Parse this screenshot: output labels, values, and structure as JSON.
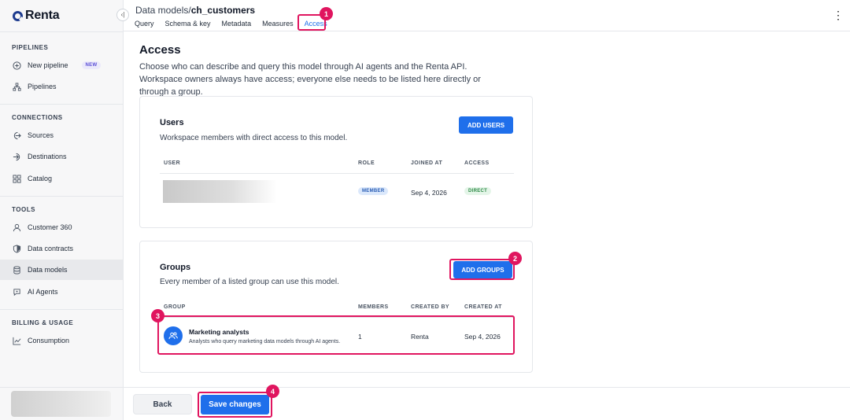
{
  "app": {
    "name": "Renta"
  },
  "sidebar": {
    "sections": [
      {
        "title": "PIPELINES",
        "items": [
          {
            "label": "New pipeline",
            "icon": "plus-circle-icon",
            "badge": "NEW"
          },
          {
            "label": "Pipelines",
            "icon": "pipelines-icon"
          }
        ]
      },
      {
        "title": "CONNECTIONS",
        "items": [
          {
            "label": "Sources",
            "icon": "sources-icon"
          },
          {
            "label": "Destinations",
            "icon": "destinations-icon"
          },
          {
            "label": "Catalog",
            "icon": "catalog-icon"
          }
        ]
      },
      {
        "title": "TOOLS",
        "items": [
          {
            "label": "Customer 360",
            "icon": "user-icon"
          },
          {
            "label": "Data contracts",
            "icon": "shield-icon"
          },
          {
            "label": "Data models",
            "icon": "database-icon",
            "active": true
          },
          {
            "label": "AI Agents",
            "icon": "ai-agents-icon"
          }
        ]
      },
      {
        "title": "BILLING & USAGE",
        "items": [
          {
            "label": "Consumption",
            "icon": "chart-icon"
          }
        ]
      }
    ]
  },
  "header": {
    "breadcrumb_parent": "Data models",
    "breadcrumb_sep": "/",
    "breadcrumb_current": "ch_customers",
    "tabs": [
      {
        "label": "Query"
      },
      {
        "label": "Schema & key"
      },
      {
        "label": "Metadata"
      },
      {
        "label": "Measures"
      },
      {
        "label": "Access",
        "active": true
      }
    ]
  },
  "main": {
    "title": "Access",
    "description": "Choose who can describe and query this model through AI agents and the Renta API. Workspace owners always have access; everyone else needs to be listed here directly or through a group.",
    "users": {
      "title": "Users",
      "description": "Workspace members with direct access to this model.",
      "add_label": "ADD USERS",
      "columns": [
        "USER",
        "ROLE",
        "JOINED AT",
        "ACCESS"
      ],
      "rows": [
        {
          "role": "MEMBER",
          "joined_at": "Sep 4, 2026",
          "access": "DIRECT"
        }
      ]
    },
    "groups": {
      "title": "Groups",
      "description": "Every member of a listed group can use this model.",
      "add_label": "ADD GROUPS",
      "columns": [
        "GROUP",
        "MEMBERS",
        "CREATED BY",
        "CREATED AT"
      ],
      "rows": [
        {
          "name": "Marketing analysts",
          "description": "Analysts who query marketing data models through AI agents.",
          "members": "1",
          "created_by": "Renta",
          "created_at": "Sep 4, 2026"
        }
      ]
    }
  },
  "footer": {
    "back_label": "Back",
    "save_label": "Save changes"
  },
  "markers": [
    "1",
    "2",
    "3",
    "4"
  ],
  "colors": {
    "accent": "#1f6feb",
    "highlight": "#e0155f"
  }
}
